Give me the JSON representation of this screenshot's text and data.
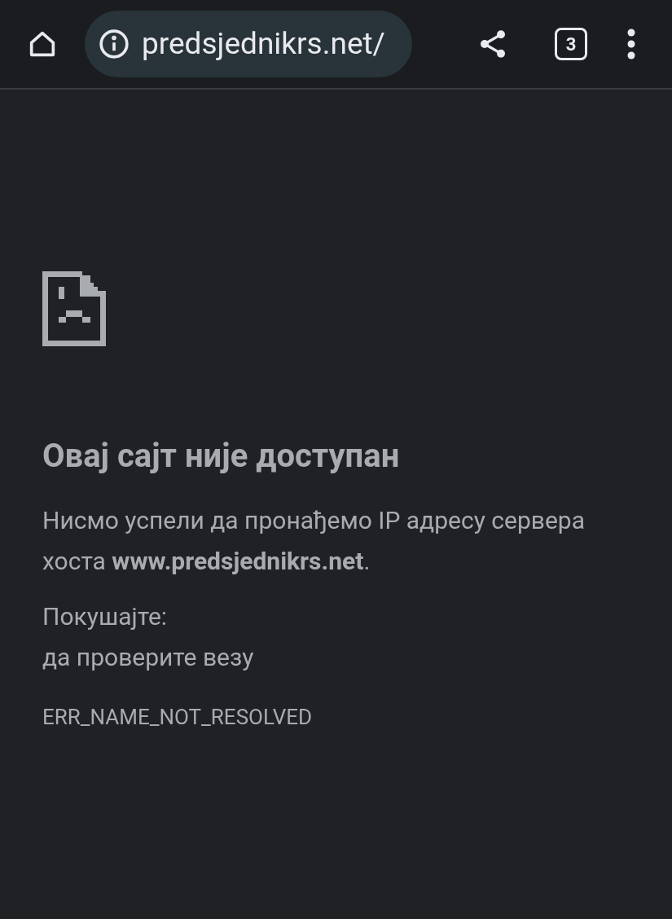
{
  "toolbar": {
    "url": "predsjednikrs.net/",
    "tab_count": "3"
  },
  "error": {
    "title": "Овај сајт није доступан",
    "message": "Нисмо успели да пронађемо IP адресу сервера хоста **www.predsjednikrs.net**.",
    "try_label": "Покушајте:",
    "suggestions": [
      "да проверите везу"
    ],
    "code": "ERR_NAME_NOT_RESOLVED"
  }
}
